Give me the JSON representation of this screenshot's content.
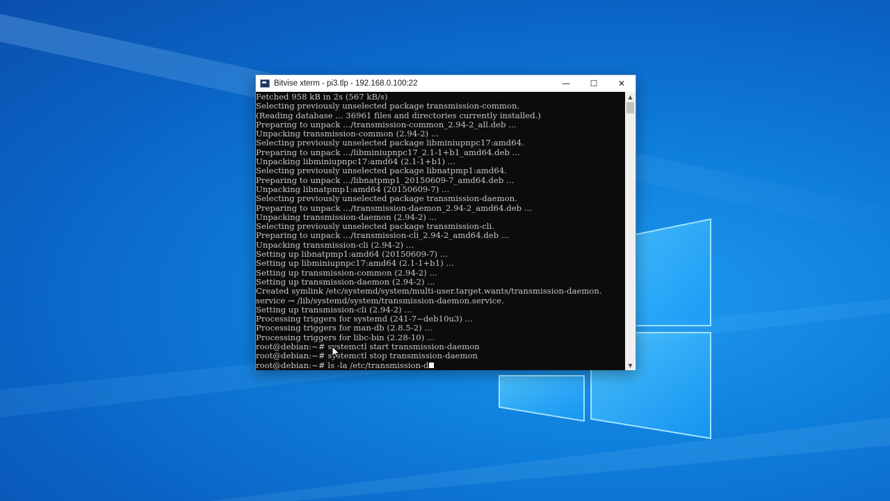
{
  "window": {
    "title": "Bitvise xterm - pi3.tlp - 192.168.0.100:22",
    "minimize_glyph": "—",
    "maximize_glyph": "☐",
    "close_glyph": "✕"
  },
  "terminal": {
    "lines": [
      "Fetched 958 kB in 2s (567 kB/s)",
      "Selecting previously unselected package transmission-common.",
      "(Reading database ... 36961 files and directories currently installed.)",
      "Preparing to unpack .../transmission-common_2.94-2_all.deb ...",
      "Unpacking transmission-common (2.94-2) ...",
      "Selecting previously unselected package libminiupnpc17:amd64.",
      "Preparing to unpack .../libminiupnpc17_2.1-1+b1_amd64.deb ...",
      "Unpacking libminiupnpc17:amd64 (2.1-1+b1) ...",
      "Selecting previously unselected package libnatpmp1:amd64.",
      "Preparing to unpack .../libnatpmp1_20150609-7_amd64.deb ...",
      "Unpacking libnatpmp1:amd64 (20150609-7) ...",
      "Selecting previously unselected package transmission-daemon.",
      "Preparing to unpack .../transmission-daemon_2.94-2_amd64.deb ...",
      "Unpacking transmission-daemon (2.94-2) ...",
      "Selecting previously unselected package transmission-cli.",
      "Preparing to unpack .../transmission-cli_2.94-2_amd64.deb ...",
      "Unpacking transmission-cli (2.94-2) ...",
      "Setting up libnatpmp1:amd64 (20150609-7) ...",
      "Setting up libminiupnpc17:amd64 (2.1-1+b1) ...",
      "Setting up transmission-common (2.94-2) ...",
      "Setting up transmission-daemon (2.94-2) ...",
      "Created symlink /etc/systemd/system/multi-user.target.wants/transmission-daemon.",
      "service → /lib/systemd/system/transmission-daemon.service.",
      "Setting up transmission-cli (2.94-2) ...",
      "Processing triggers for systemd (241-7~deb10u3) ...",
      "Processing triggers for man-db (2.8.5-2) ...",
      "Processing triggers for libc-bin (2.28-10) ...",
      "root@debian:~# systemctl start transmission-daemon",
      "root@debian:~# systemctl stop transmission-daemon"
    ],
    "current_line": "root@debian:~# ls -la /etc/transmission-d"
  },
  "icons": {
    "app": "bitvise-xterm-icon",
    "minimize": "minimize-icon",
    "maximize": "maximize-icon",
    "close": "close-icon"
  },
  "colors": {
    "terminal_bg": "#0c0c0c",
    "terminal_fg": "#c8c8c8",
    "desktop_accent": "#0f7fdc"
  }
}
